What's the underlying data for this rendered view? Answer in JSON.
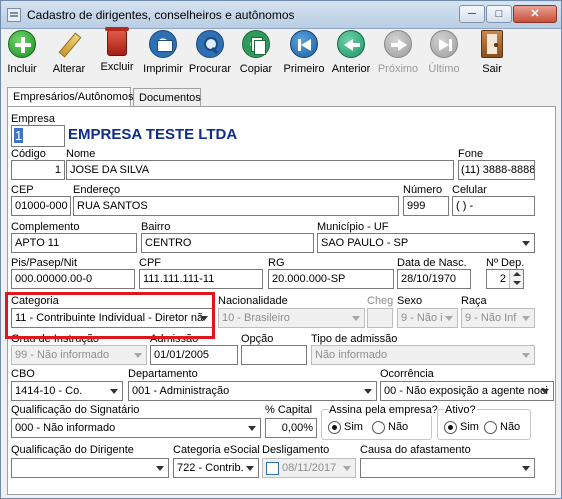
{
  "window": {
    "title": "Cadastro de dirigentes, conselheiros e autônomos",
    "min_label": "─",
    "max_label": "□",
    "close_label": "✕"
  },
  "toolbar": {
    "incluir": "Incluir",
    "alterar": "Alterar",
    "excluir": "Excluir",
    "imprimir": "Imprimir",
    "procurar": "Procurar",
    "copiar": "Copiar",
    "primeiro": "Primeiro",
    "anterior": "Anterior",
    "proximo": "Próximo",
    "ultimo": "Último",
    "sair": "Sair"
  },
  "tabs": {
    "empresas": "Empresários/Autônomos",
    "documentos": "Documentos"
  },
  "form": {
    "empresa_label": "Empresa",
    "empresa_code": "1",
    "empresa_name": "EMPRESA TESTE LTDA",
    "codigo_label": "Código",
    "codigo_value": "1",
    "nome_label": "Nome",
    "nome_value": "JOSE DA SILVA",
    "fone_label": "Fone",
    "fone_value": "(11) 3888-8888",
    "cep_label": "CEP",
    "cep_value": "01000-000",
    "endereco_label": "Endereço",
    "endereco_value": "RUA SANTOS",
    "numero_label": "Número",
    "numero_value": "999",
    "celular_label": "Celular",
    "celular_value": "( )    -",
    "complemento_label": "Complemento",
    "complemento_value": "APTO 11",
    "bairro_label": "Bairro",
    "bairro_value": "CENTRO",
    "municipio_label": "Município - UF",
    "municipio_value": "SAO PAULO - SP",
    "pis_label": "Pis/Pasep/Nit",
    "pis_value": "000.00000.00-0",
    "cpf_label": "CPF",
    "cpf_value": "111.111.111-11",
    "rg_label": "RG",
    "rg_value": "20.000.000-SP",
    "nasc_label": "Data de Nasc.",
    "nasc_value": "28/10/1970",
    "dep_label": "Nº Dep.",
    "dep_value": "2",
    "categoria_label": "Categoria",
    "categoria_value": "11 - Contribuinte Individual - Diretor nã",
    "nacionalidade_label": "Nacionalidade",
    "nacionalidade_value": "10 - Brasileiro",
    "cheg_label": "Cheg",
    "sexo_label": "Sexo",
    "sexo_value": "9 - Não i",
    "raca_label": "Raça",
    "raca_value": "9 - Não Inf",
    "instrucao_label": "Grau de Instrução",
    "instrucao_value": "99 - Não informado",
    "admissao_label": "Admissão",
    "admissao_value": "01/01/2005",
    "opcao_label": "Opção",
    "tipo_adm_label": "Tipo de admissão",
    "tipo_adm_value": "Não informado",
    "cbo_label": "CBO",
    "cbo_value": "1414-10 - Co.",
    "departamento_label": "Departamento",
    "departamento_value": "001 - Administração",
    "ocorrencia_label": "Ocorrência",
    "ocorrencia_value": "00 - Não exposição a agente noci",
    "qual_signatario_label": "Qualificação do Signatário",
    "qual_signatario_value": "000 -  Não informado",
    "capital_label": "% Capital",
    "capital_value": "0,00%",
    "assina_label": "Assina pela empresa?",
    "sim_label": "Sim",
    "nao_label": "Não",
    "ativo_label": "Ativo?",
    "qual_dirigente_label": "Qualificação do Dirigente",
    "cat_esocial_label": "Categoria eSocial",
    "cat_esocial_value": "722 - Contrib.",
    "desligamento_label": "Desligamento",
    "desligamento_value": "08/11/2017",
    "causa_label": "Causa do afastamento"
  }
}
